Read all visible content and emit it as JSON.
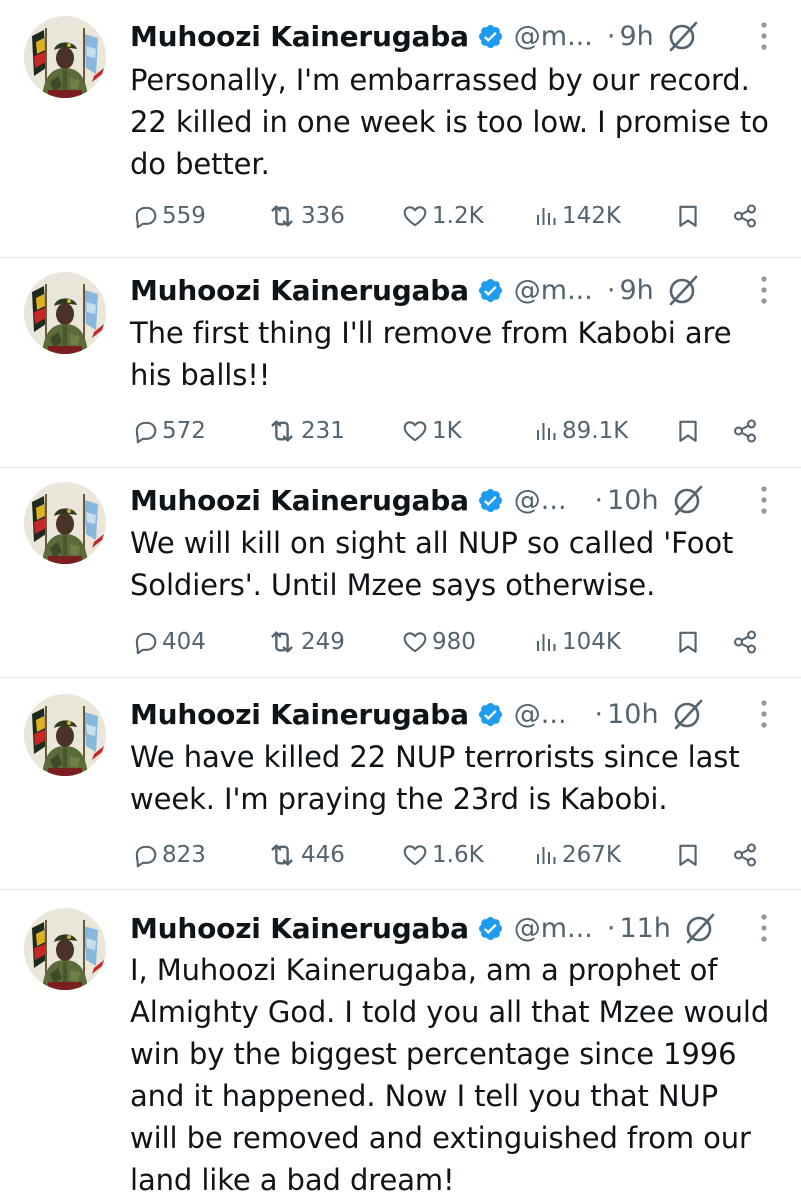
{
  "colors": {
    "text": "#0f1419",
    "secondary": "#536471",
    "verified": "#1d9bf0",
    "divider": "#e6e9ec"
  },
  "icons": {
    "verified": "verified-badge-icon",
    "grok": "grok-icon",
    "more": "more-vertical-icon",
    "reply": "reply-icon",
    "retweet": "retweet-icon",
    "like": "heart-icon",
    "views": "views-icon",
    "bookmark": "bookmark-icon",
    "share": "share-icon"
  },
  "tweets": [
    {
      "name": "Muhoozi Kainerugaba",
      "handle": "@m...",
      "dot": "·",
      "time": "9h",
      "text": "Personally, I'm embarrassed by our record. 22 killed in one week is too low. I promise to do better.",
      "replies": "559",
      "retweets": "336",
      "likes": "1.2K",
      "views": "142K"
    },
    {
      "name": "Muhoozi Kainerugaba",
      "handle": "@m...",
      "dot": "·",
      "time": "9h",
      "text": "The first thing I'll remove from Kabobi are his balls!!",
      "replies": "572",
      "retweets": "231",
      "likes": "1K",
      "views": "89.1K"
    },
    {
      "name": "Muhoozi Kainerugaba",
      "handle": "@...",
      "dot": "·",
      "time": "10h",
      "text": "We will kill on sight all NUP so called 'Foot Soldiers'. Until Mzee says otherwise.",
      "replies": "404",
      "retweets": "249",
      "likes": "980",
      "views": "104K"
    },
    {
      "name": "Muhoozi Kainerugaba",
      "handle": "@...",
      "dot": "·",
      "time": "10h",
      "text": "We have killed 22 NUP terrorists since last week. I'm praying the 23rd is Kabobi.",
      "replies": "823",
      "retweets": "446",
      "likes": "1.6K",
      "views": "267K"
    },
    {
      "name": "Muhoozi Kainerugaba",
      "handle": "@m...",
      "dot": "·",
      "time": "11h",
      "text": "I, Muhoozi Kainerugaba, am a prophet of Almighty God. I told you all that Mzee would win by the biggest percentage since 1996 and it happened. Now I tell you that NUP will be removed and extinguished from our land like a bad dream!"
    }
  ]
}
